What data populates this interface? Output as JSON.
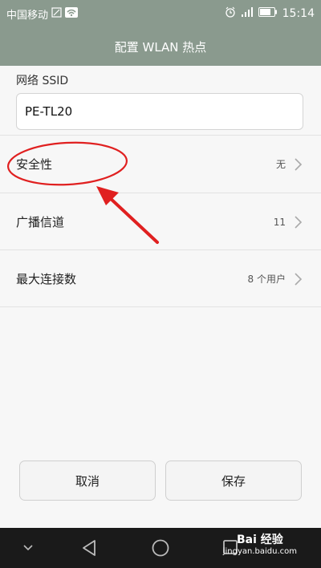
{
  "status_bar": {
    "carrier": "中国移动",
    "time": "15:14"
  },
  "header": {
    "title": "配置 WLAN 热点"
  },
  "ssid": {
    "label": "网络 SSID",
    "value": "PE-TL20"
  },
  "settings": [
    {
      "label": "安全性",
      "value": "无"
    },
    {
      "label": "广播信道",
      "value": "11"
    },
    {
      "label": "最大连接数",
      "value": "8 个用户"
    }
  ],
  "buttons": {
    "cancel_label": "取消",
    "save_label": "保存"
  },
  "watermark": {
    "brand": "Bai 经验",
    "url": "jingyan.baidu.com"
  },
  "icons": {
    "sim": "sim-icon",
    "wifi": "wifi-icon",
    "alarm": "alarm-icon",
    "signal": "signal-icon",
    "battery": "battery-icon",
    "chevron": "chevron-right-icon",
    "nav_down": "chevron-down-icon",
    "nav_back": "back-triangle-icon",
    "nav_home": "home-circle-icon"
  },
  "colors": {
    "header_bg": "#8a9a8e",
    "annotation": "#e02020",
    "nav_bg": "#1a1a1a"
  }
}
